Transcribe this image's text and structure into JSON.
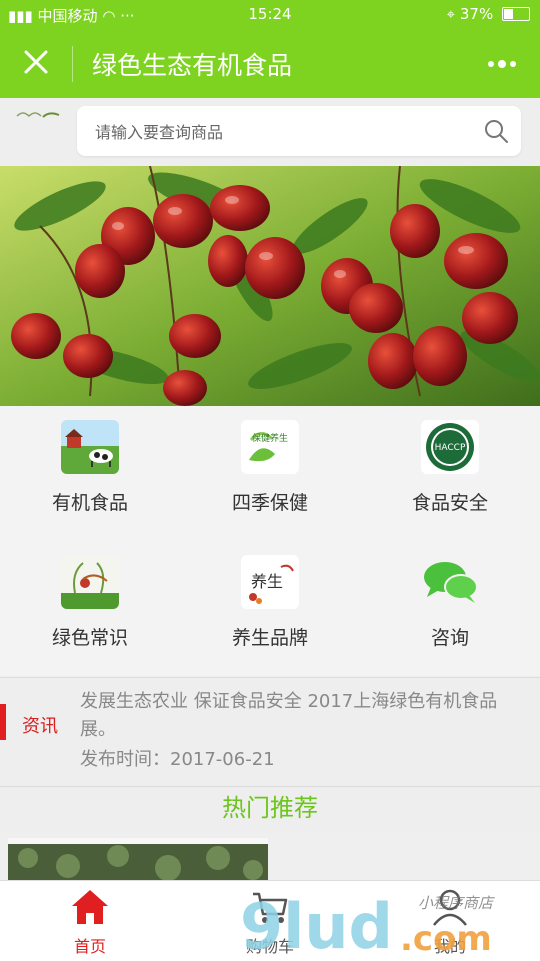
{
  "status_bar": {
    "carrier": "中国移动",
    "time": "15:24",
    "battery": "37%"
  },
  "header": {
    "title": "绿色生态有机食品",
    "close_icon": "close-icon",
    "more_icon": "more-dots-icon"
  },
  "search": {
    "placeholder": "请输入要查询商品",
    "icon": "search-icon"
  },
  "categories": [
    {
      "label": "有机食品",
      "icon": "organic-food-icon"
    },
    {
      "label": "四季保健",
      "icon": "health-icon"
    },
    {
      "label": "食品安全",
      "icon": "haccp-icon"
    },
    {
      "label": "绿色常识",
      "icon": "green-knowledge-icon"
    },
    {
      "label": "养生品牌",
      "icon": "health-brand-icon"
    },
    {
      "label": "咨询",
      "icon": "chat-icon"
    }
  ],
  "category_icon_text": {
    "health": "保健养生",
    "haccp": "HACCP",
    "brand": "养生"
  },
  "news": {
    "tag": "资讯",
    "text": "发展生态农业 保证食品安全 2017上海绿色有机食品展。",
    "date": "发布时间：2017-06-21"
  },
  "hot_section": {
    "title": "热门推荐"
  },
  "tabs": [
    {
      "label": "首页",
      "icon": "home-icon",
      "active": true
    },
    {
      "label": "购物车",
      "icon": "cart-icon",
      "active": false
    },
    {
      "label": "我的",
      "icon": "user-icon",
      "active": false
    }
  ],
  "watermark": {
    "brand": "9lud",
    "suffix": ".com",
    "tagline": "小程序商店"
  },
  "colors": {
    "brand_green": "#7ed321",
    "active_red": "#e02020",
    "hot_title_green": "#6cc51a"
  }
}
